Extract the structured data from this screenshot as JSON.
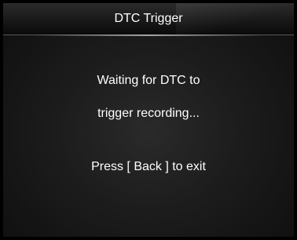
{
  "header": {
    "title": "DTC Trigger"
  },
  "message": {
    "line1": "Waiting for DTC to",
    "line2": "trigger recording...",
    "exit_hint": "Press [ Back ] to exit"
  }
}
